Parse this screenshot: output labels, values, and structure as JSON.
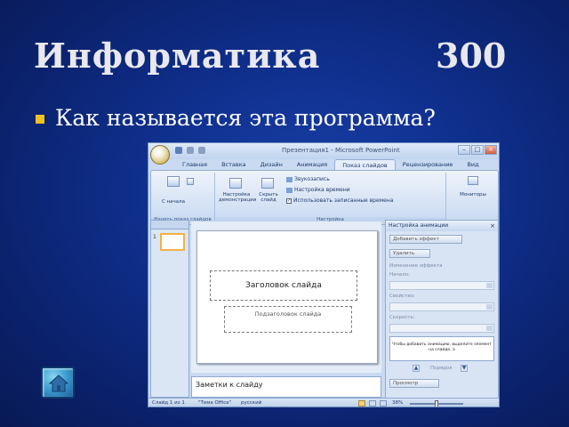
{
  "slide": {
    "title": "Информатика",
    "score": "300",
    "question": "Как называется эта программа?"
  },
  "screenshot": {
    "window_title": "Презентация1 - Microsoft PowerPoint",
    "tabs": [
      "Главная",
      "Вставка",
      "Дизайн",
      "Анимация",
      "Показ слайдов",
      "Рецензирование",
      "Вид"
    ],
    "active_tab": "Показ слайдов",
    "ribbon": {
      "group1_button": "С начала",
      "group1_label": "Начать показ слайдов",
      "setup_button": "Настройка демонстрации",
      "hide_button": "Скрыть слайд",
      "record_narration": "Звукозапись",
      "rehearse_timings": "Настройка времени",
      "use_timings": "Использовать записанные времена",
      "group2_label": "Настройка",
      "monitors_button": "Мониторы"
    },
    "slide_number": "1",
    "title_placeholder": "Заголовок слайда",
    "subtitle_placeholder": "Подзаголовок слайда",
    "notes_placeholder": "Заметки к слайду",
    "task_pane": {
      "title": "Настройка анимации",
      "add_effect": "Добавить эффект",
      "remove": "Удалить",
      "modify_label": "Изменение эффекта",
      "start_label": "Начало:",
      "property_label": "Свойство:",
      "speed_label": "Скорость:",
      "list_text": "Чтобы добавить анимацию, выделите элемент на слайде, а",
      "reorder_label": "Порядок",
      "play_button": "Просмотр"
    },
    "statusbar": {
      "slide_info": "Слайд 1 из 1",
      "theme": "\"Тема Office\"",
      "language": "русский",
      "zoom": "38%"
    }
  },
  "colors": {
    "background": "#0f2f8c",
    "title_text": "#e8e8ee",
    "bullet": "#f0c020"
  },
  "icons": {
    "home": "home-icon",
    "bullet": "bullet-square"
  }
}
